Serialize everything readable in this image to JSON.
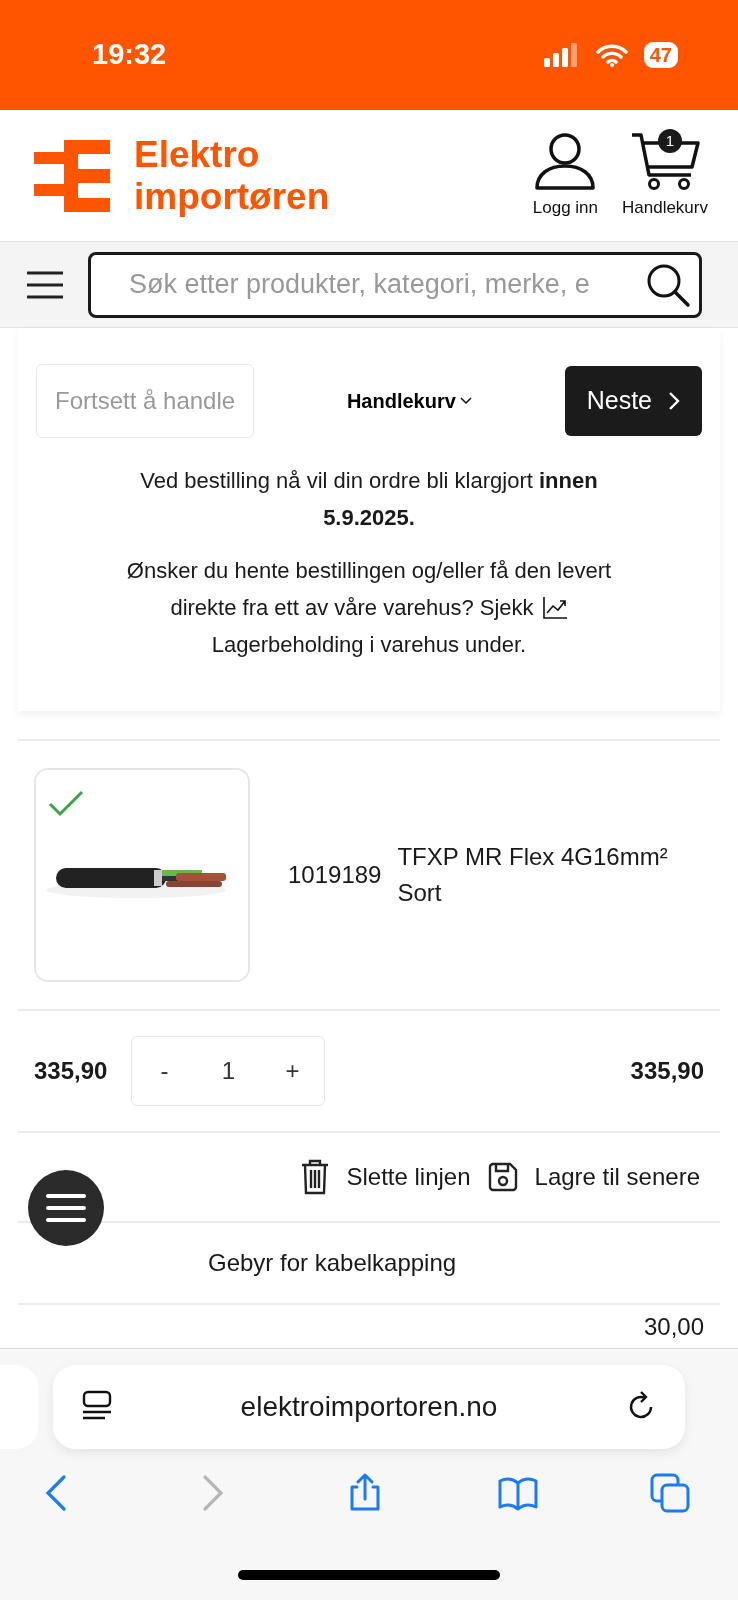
{
  "status_bar": {
    "time": "19:32",
    "battery": "47"
  },
  "header": {
    "logo_lines": [
      "Elektro",
      "importøren"
    ],
    "actions": [
      {
        "kind": "user",
        "label": "Logg inn"
      },
      {
        "kind": "cart",
        "label": "Handlekurv",
        "badge": "1"
      }
    ]
  },
  "search": {
    "placeholder": "Søk etter produkter, kategori, merke, e"
  },
  "checkout_nav": {
    "back": "Fortsett å handle",
    "step": "Handlekurv",
    "next": "Neste"
  },
  "notice": {
    "delivery": "Ved bestilling nå vil din ordre bli klargjort **innen 5.9.2025.**",
    "stock_before": [
      "Ønsker du hente bestillingen og/eller få den levert",
      "direkte fra ett av våre varehus? Sjekk"
    ],
    "stock_after": "Lagerbeholding i varehus under."
  },
  "cart_line": {
    "in_stock": true,
    "sku": "1019189",
    "name": "TFXP MR Flex 4G16mm² Sort",
    "unit_price": "335,90",
    "quantity": "1",
    "minus": "-",
    "plus": "+",
    "total": "335,90",
    "actions": [
      {
        "kind": "delete",
        "label": "Slette linjen"
      },
      {
        "kind": "save",
        "label": "Lagre til senere"
      }
    ]
  },
  "fee_line": {
    "name": "Gebyr for kabelkapping",
    "price": "30,00"
  },
  "browser": {
    "url": "elektroimportoren.no",
    "nav": [
      {
        "kind": "back",
        "disabled": false
      },
      {
        "kind": "forward",
        "disabled": true
      },
      {
        "kind": "share",
        "disabled": false
      },
      {
        "kind": "bookmarks",
        "disabled": false
      },
      {
        "kind": "tabs",
        "disabled": false
      }
    ]
  }
}
